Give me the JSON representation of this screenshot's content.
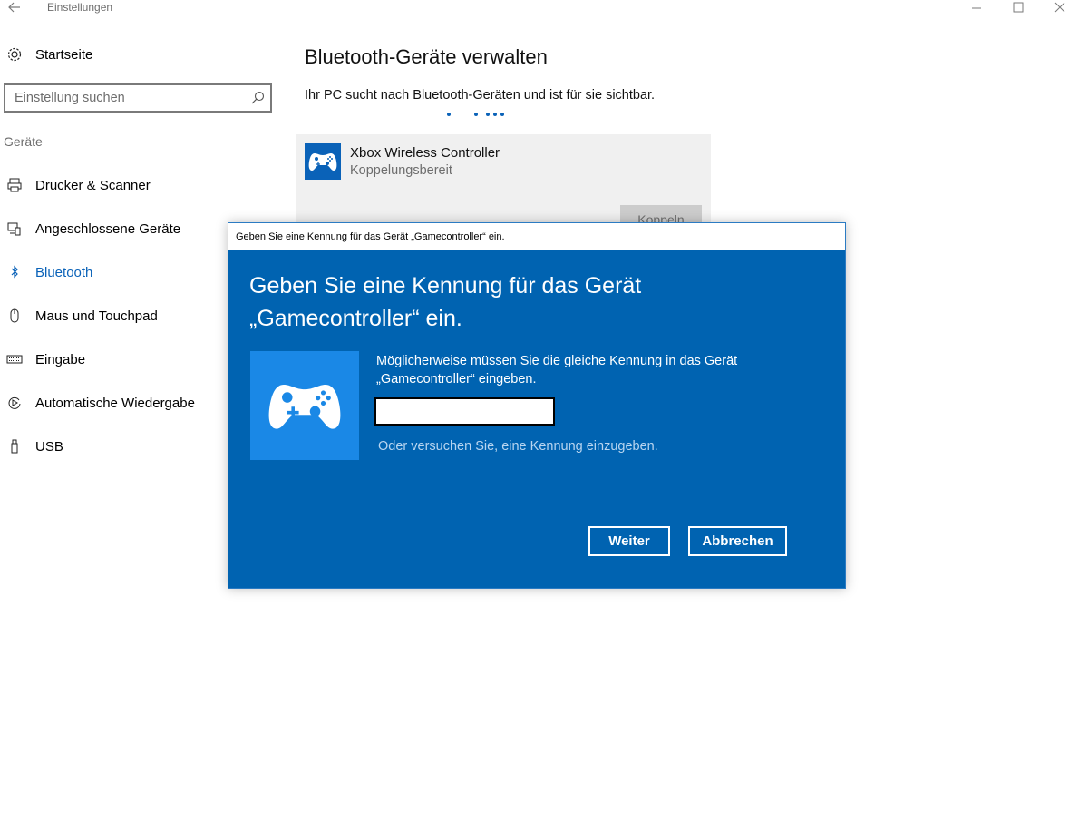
{
  "window": {
    "title": "Einstellungen"
  },
  "sidebar": {
    "home_label": "Startseite",
    "search_placeholder": "Einstellung suchen",
    "section_label": "Geräte",
    "items": [
      {
        "label": "Drucker & Scanner",
        "icon": "printer-icon"
      },
      {
        "label": "Angeschlossene Geräte",
        "icon": "connected-devices-icon"
      },
      {
        "label": "Bluetooth",
        "icon": "bluetooth-icon",
        "active": true
      },
      {
        "label": "Maus und Touchpad",
        "icon": "mouse-icon"
      },
      {
        "label": "Eingabe",
        "icon": "keyboard-icon"
      },
      {
        "label": "Automatische Wiedergabe",
        "icon": "autoplay-icon"
      },
      {
        "label": "USB",
        "icon": "usb-icon"
      }
    ]
  },
  "main": {
    "title": "Bluetooth-Geräte verwalten",
    "description": "Ihr PC sucht nach Bluetooth-Geräten und ist für sie sichtbar.",
    "device": {
      "name": "Xbox Wireless Controller",
      "status": "Koppelungsbereit",
      "pair_label": "Koppeln"
    }
  },
  "dialog": {
    "window_title": "Geben Sie eine Kennung für das Gerät „Gamecontroller“ ein.",
    "heading_line1": "Geben Sie eine Kennung für das Gerät",
    "heading_line2": "„Gamecontroller“ ein.",
    "instruction_line1": "Möglicherweise müssen Sie die gleiche Kennung in das Gerät",
    "instruction_line2": "„Gamecontroller“ eingeben.",
    "pin_value": "",
    "alternative_text": "Oder versuchen Sie, eine Kennung einzugeben.",
    "next_label": "Weiter",
    "cancel_label": "Abbrechen"
  },
  "colors": {
    "accent": "#0063b1",
    "accent_tile": "#1a88e6",
    "link_blue": "#0a62b8"
  }
}
